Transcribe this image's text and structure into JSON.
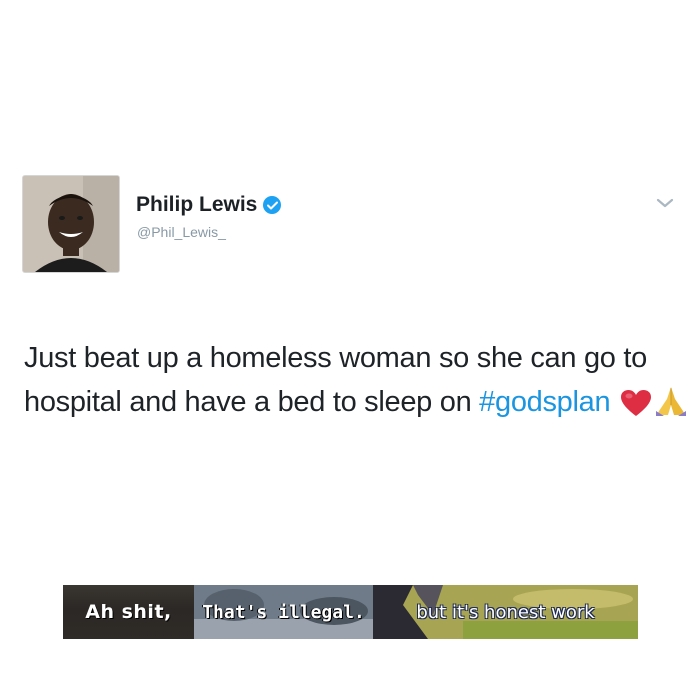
{
  "tweet": {
    "display_name": "Philip Lewis",
    "handle": "@Phil_Lewis_",
    "verified": true,
    "text_before_hashtag": "Just beat up a homeless woman so she can go to hospital and have a bed to sleep on ",
    "hashtag": "#godsplan",
    "emojis": [
      "heart-emoji",
      "praying-hands-emoji"
    ],
    "colors": {
      "hashtag": "#1b95e0",
      "handle": "#8899a6",
      "verified_badge": "#1da1f2"
    }
  },
  "caption": {
    "segment_1": "Ah shit,",
    "segment_2": "That's illegal.",
    "segment_3": "but it's honest work"
  }
}
